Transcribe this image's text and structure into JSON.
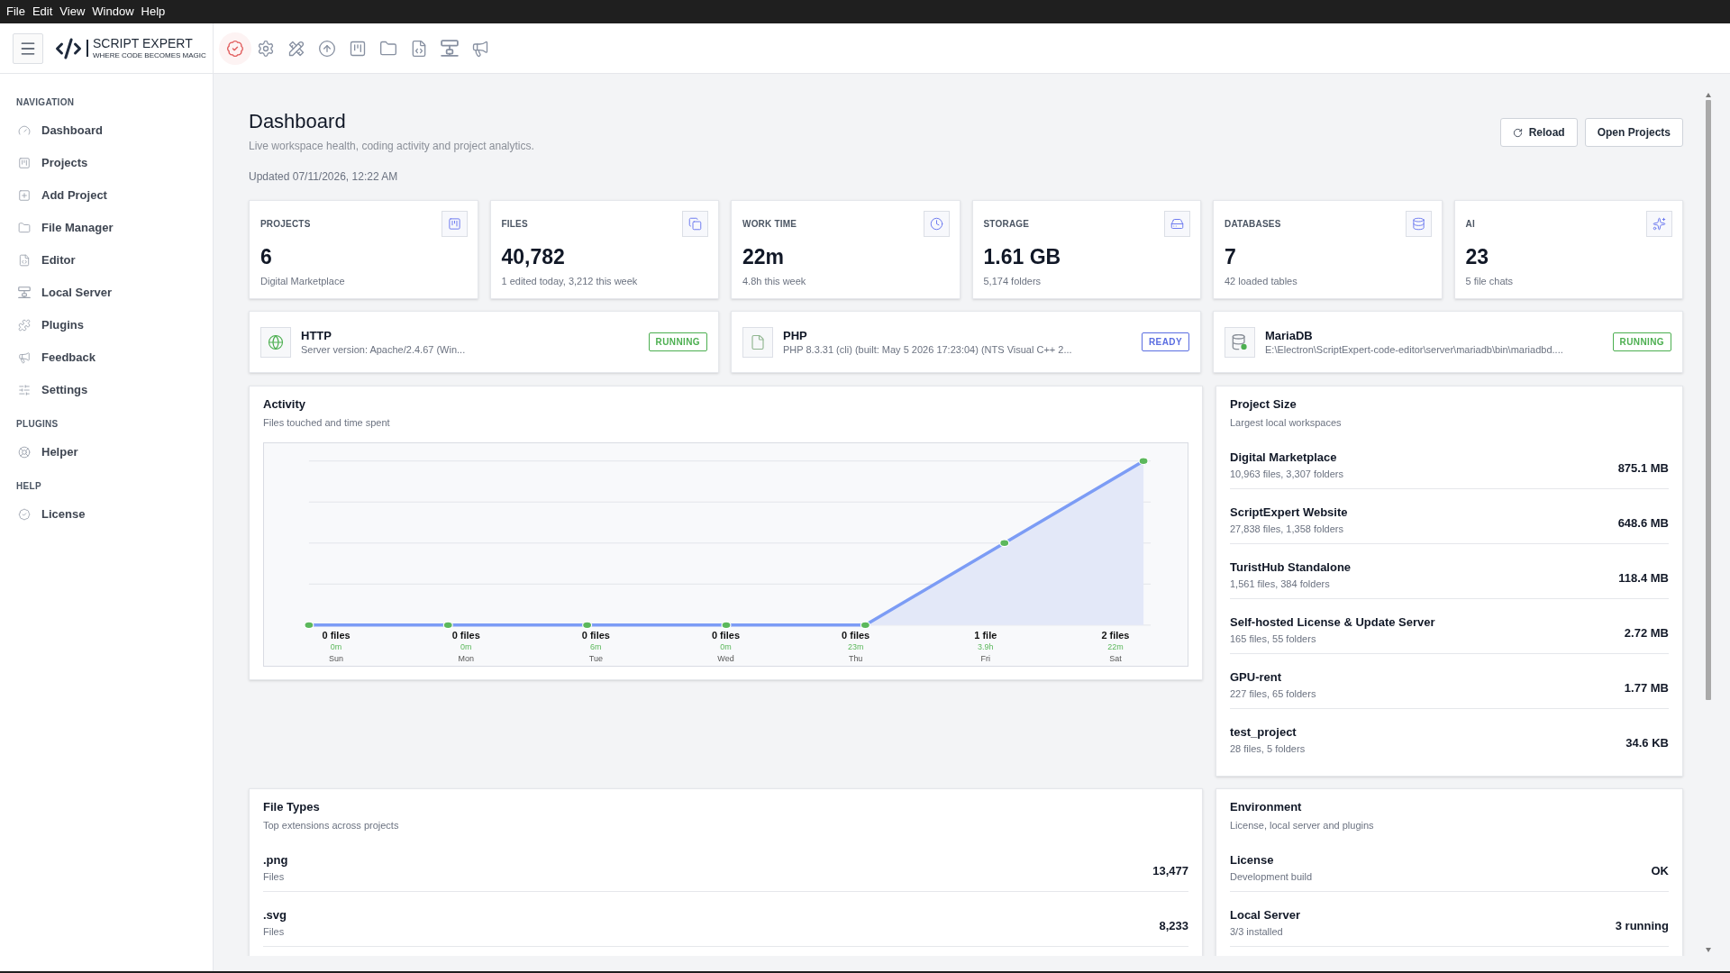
{
  "menu_bar": [
    "File",
    "Edit",
    "View",
    "Window",
    "Help"
  ],
  "logo": {
    "name": "SCRIPT EXPERT",
    "tagline": "WHERE CODE BECOMES MAGIC"
  },
  "sidebar": {
    "sections": [
      {
        "title": "NAVIGATION",
        "items": [
          "Dashboard",
          "Projects",
          "Add Project",
          "File Manager",
          "Editor",
          "Local Server",
          "Plugins",
          "Feedback",
          "Settings"
        ]
      },
      {
        "title": "PLUGINS",
        "items": [
          "Helper"
        ]
      },
      {
        "title": "HELP",
        "items": [
          "License"
        ]
      }
    ]
  },
  "page": {
    "title": "Dashboard",
    "subtitle": "Live workspace health, coding activity and project analytics.",
    "updated": "Updated 07/11/2026, 12:22 AM",
    "actions": [
      {
        "label": "Reload",
        "kind": "reload"
      },
      {
        "label": "Open Projects",
        "kind": "plain"
      }
    ]
  },
  "stats": [
    {
      "label": "PROJECTS",
      "value": "6",
      "detail": "Digital Marketplace"
    },
    {
      "label": "FILES",
      "value": "40,782",
      "detail": "1 edited today, 3,212 this week"
    },
    {
      "label": "WORK TIME",
      "value": "22m",
      "detail": "4.8h this week"
    },
    {
      "label": "STORAGE",
      "value": "1.61 GB",
      "detail": "5,174 folders"
    },
    {
      "label": "DATABASES",
      "value": "7",
      "detail": "42 loaded tables"
    },
    {
      "label": "AI",
      "value": "23",
      "detail": "5 file chats"
    }
  ],
  "services": [
    {
      "name": "HTTP",
      "detail": "Server version: Apache/2.4.67 (Win...",
      "status": "RUNNING",
      "color": "#4caf50"
    },
    {
      "name": "PHP",
      "detail": "PHP 8.3.31 (cli) (built: May 5 2026 17:23:04) (NTS Visual C++ 2...",
      "status": "READY",
      "color": "#5b6ee1"
    },
    {
      "name": "MariaDB",
      "detail": "E:\\Electron\\ScriptExpert-code-editor\\server\\mariadb\\bin\\mariadbd....",
      "status": "RUNNING",
      "color": "#4caf50"
    }
  ],
  "activity": {
    "title": "Activity",
    "subtitle": "Files touched and time spent",
    "days": [
      {
        "files": "0 files",
        "time": "0m",
        "day": "Sun"
      },
      {
        "files": "0 files",
        "time": "0m",
        "day": "Mon"
      },
      {
        "files": "0 files",
        "time": "6m",
        "day": "Tue"
      },
      {
        "files": "0 files",
        "time": "0m",
        "day": "Wed"
      },
      {
        "files": "0 files",
        "time": "23m",
        "day": "Thu"
      },
      {
        "files": "1 file",
        "time": "3.9h",
        "day": "Fri"
      },
      {
        "files": "2 files",
        "time": "22m",
        "day": "Sat"
      }
    ]
  },
  "project_size": {
    "title": "Project Size",
    "subtitle": "Largest local workspaces",
    "rows": [
      {
        "name": "Digital Marketplace",
        "detail": "10,963 files, 3,307 folders",
        "size": "875.1 MB"
      },
      {
        "name": "ScriptExpert Website",
        "detail": "27,838 files, 1,358 folders",
        "size": "648.6 MB"
      },
      {
        "name": "TuristHub Standalone",
        "detail": "1,561 files, 384 folders",
        "size": "118.4 MB"
      },
      {
        "name": "Self-hosted License & Update Server",
        "detail": "165 files, 55 folders",
        "size": "2.72 MB"
      },
      {
        "name": "GPU-rent",
        "detail": "227 files, 65 folders",
        "size": "1.77 MB"
      },
      {
        "name": "test_project",
        "detail": "28 files, 5 folders",
        "size": "34.6 KB"
      }
    ]
  },
  "file_types": {
    "title": "File Types",
    "subtitle": "Top extensions across projects",
    "rows": [
      {
        "name": ".png",
        "detail": "Files",
        "value": "13,477"
      },
      {
        "name": ".svg",
        "detail": "Files",
        "value": "8,233"
      }
    ]
  },
  "environment": {
    "title": "Environment",
    "subtitle": "License, local server and plugins",
    "rows": [
      {
        "name": "License",
        "detail": "Development build",
        "value": "OK"
      },
      {
        "name": "Local Server",
        "detail": "3/3 installed",
        "value": "3 running"
      }
    ]
  }
}
